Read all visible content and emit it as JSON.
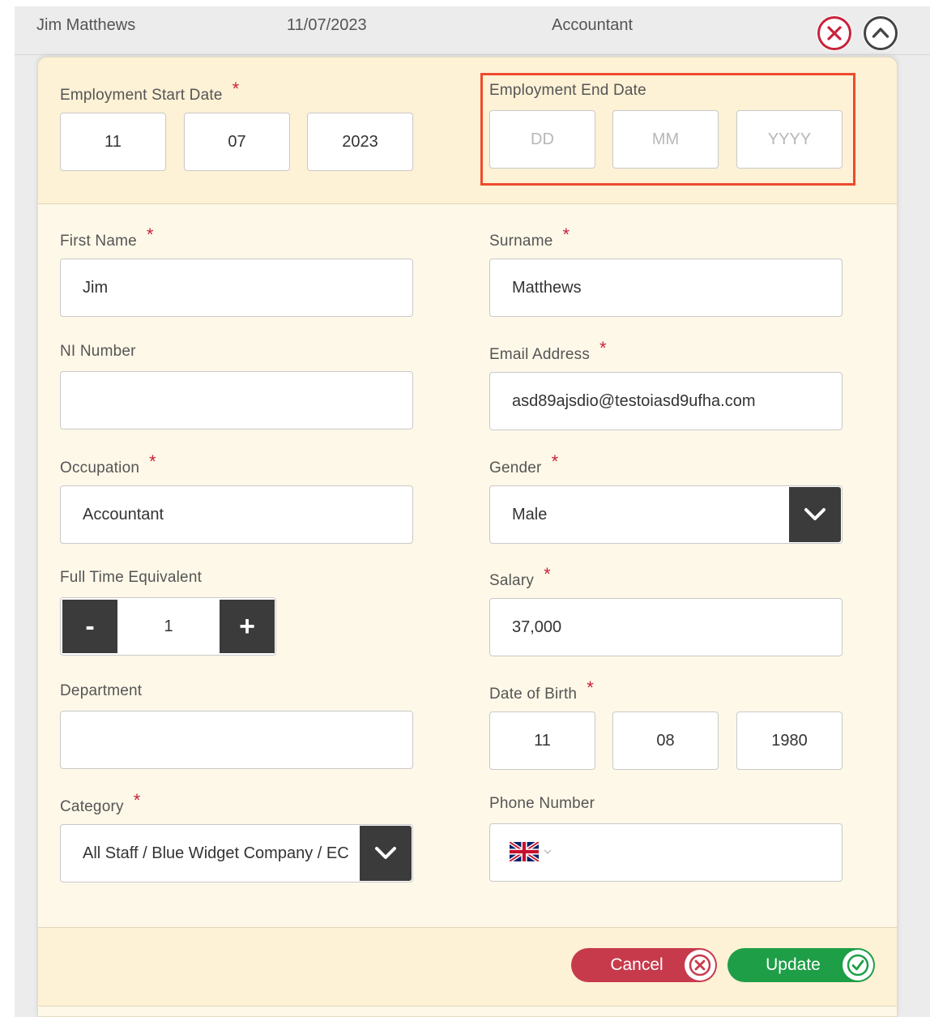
{
  "summary": {
    "name": "Jim Matthews",
    "date": "11/07/2023",
    "role": "Accountant",
    "close_icon": "close-circle-icon",
    "collapse_icon": "chevron-up-circle-icon"
  },
  "employment": {
    "start_label": "Employment Start Date",
    "start_day": "11",
    "start_month": "07",
    "start_year": "2023",
    "end_label": "Employment End Date",
    "end_day_placeholder": "DD",
    "end_month_placeholder": "MM",
    "end_year_placeholder": "YYYY"
  },
  "form": {
    "first_name_label": "First Name",
    "first_name_value": "Jim",
    "surname_label": "Surname",
    "surname_value": "Matthews",
    "ni_label": "NI Number",
    "ni_value": "",
    "email_label": "Email Address",
    "email_value": "asd89ajsdio@testoiasd9ufha.com",
    "occupation_label": "Occupation",
    "occupation_value": "Accountant",
    "gender_label": "Gender",
    "gender_value": "Male",
    "fte_label": "Full Time Equivalent",
    "fte_minus": "-",
    "fte_value": "1",
    "fte_plus": "+",
    "salary_label": "Salary",
    "salary_value": "37,000",
    "department_label": "Department",
    "department_value": "",
    "dob_label": "Date of Birth",
    "dob_day": "11",
    "dob_month": "08",
    "dob_year": "1980",
    "category_label": "Category",
    "category_value": "All Staff / Blue Widget Company / EC",
    "phone_label": "Phone Number",
    "phone_value": "",
    "phone_flag_icon": "uk-flag-icon",
    "required_mark": "*"
  },
  "actions": {
    "cancel_label": "Cancel",
    "update_label": "Update"
  },
  "colors": {
    "required": "#c8233c",
    "cancel": "#c73a4c",
    "update": "#1e9e46",
    "highlight": "#ee4a2c"
  }
}
